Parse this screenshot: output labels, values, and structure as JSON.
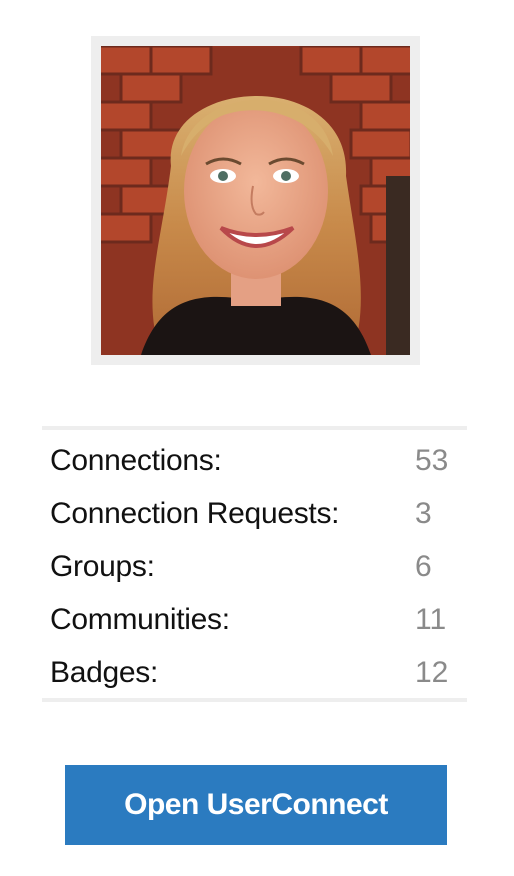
{
  "profile": {
    "photo_subject": "smiling woman with shoulder-length blonde hair in front of a red brick wall"
  },
  "stats": [
    {
      "label": "Connections:",
      "value": "53"
    },
    {
      "label": "Connection Requests:",
      "value": "3"
    },
    {
      "label": "Groups:",
      "value": "6"
    },
    {
      "label": "Communities:",
      "value": "11"
    },
    {
      "label": "Badges:",
      "value": "12"
    }
  ],
  "actions": {
    "open_label": "Open UserConnect"
  },
  "colors": {
    "button_bg": "#2b7bc0",
    "button_text": "#ffffff",
    "label_text": "#111111",
    "value_text": "#8a8a8a",
    "divider": "#eeeeee"
  }
}
